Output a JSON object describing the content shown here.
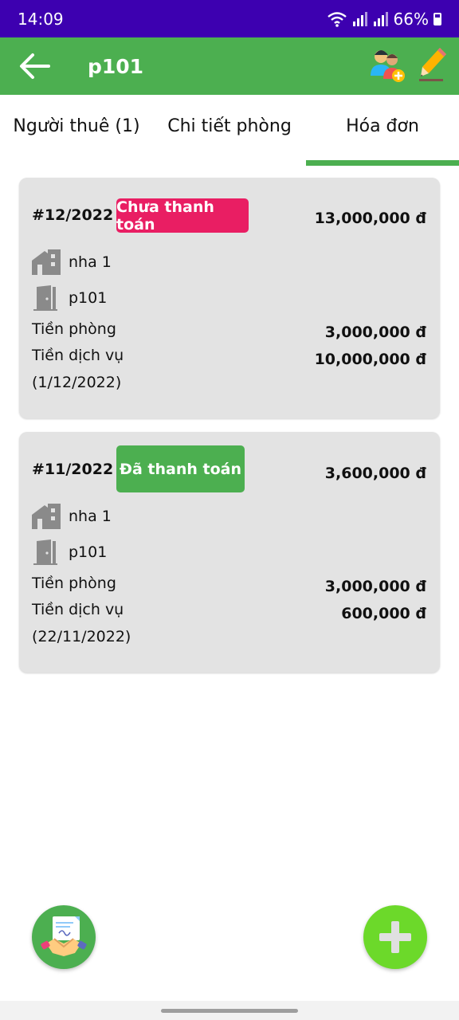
{
  "status": {
    "time": "14:09",
    "battery": "66%"
  },
  "appbar": {
    "title": "p101"
  },
  "tabs": [
    {
      "label": "Người thuê (1)"
    },
    {
      "label": "Chi tiết phòng"
    },
    {
      "label": "Hóa đơn",
      "active": true
    }
  ],
  "colors": {
    "primary": "#4caf50",
    "status_bar": "#3d00b0",
    "unpaid": "#e91e63",
    "paid": "#4caf50",
    "card_bg": "#e3e3e3",
    "fab_add": "#6cd92a"
  },
  "invoices": [
    {
      "id": "#12/2022",
      "status": "Chưa thanh toán",
      "total": "13,000,000 đ",
      "house": "nha 1",
      "room": "p101",
      "room_fee_label": "Tiền phòng",
      "room_fee": "3,000,000 đ",
      "service_fee_label": "Tiền dịch vụ",
      "service_fee": "10,000,000 đ",
      "date": "(1/12/2022)"
    },
    {
      "id": "#11/2022",
      "status": "Đã thanh toán",
      "total": "3,600,000 đ",
      "house": "nha 1",
      "room": "p101",
      "room_fee_label": "Tiền phòng",
      "room_fee": "3,000,000 đ",
      "service_fee_label": "Tiền dịch vụ",
      "service_fee": "600,000 đ",
      "date": "(22/11/2022)"
    }
  ],
  "icons": {
    "back": "arrow-left-icon",
    "add_tenant": "add-tenant-icon",
    "edit": "pencil-icon",
    "house": "house-icon",
    "door": "door-icon",
    "contract": "handshake-contract-icon",
    "add": "plus-icon"
  }
}
